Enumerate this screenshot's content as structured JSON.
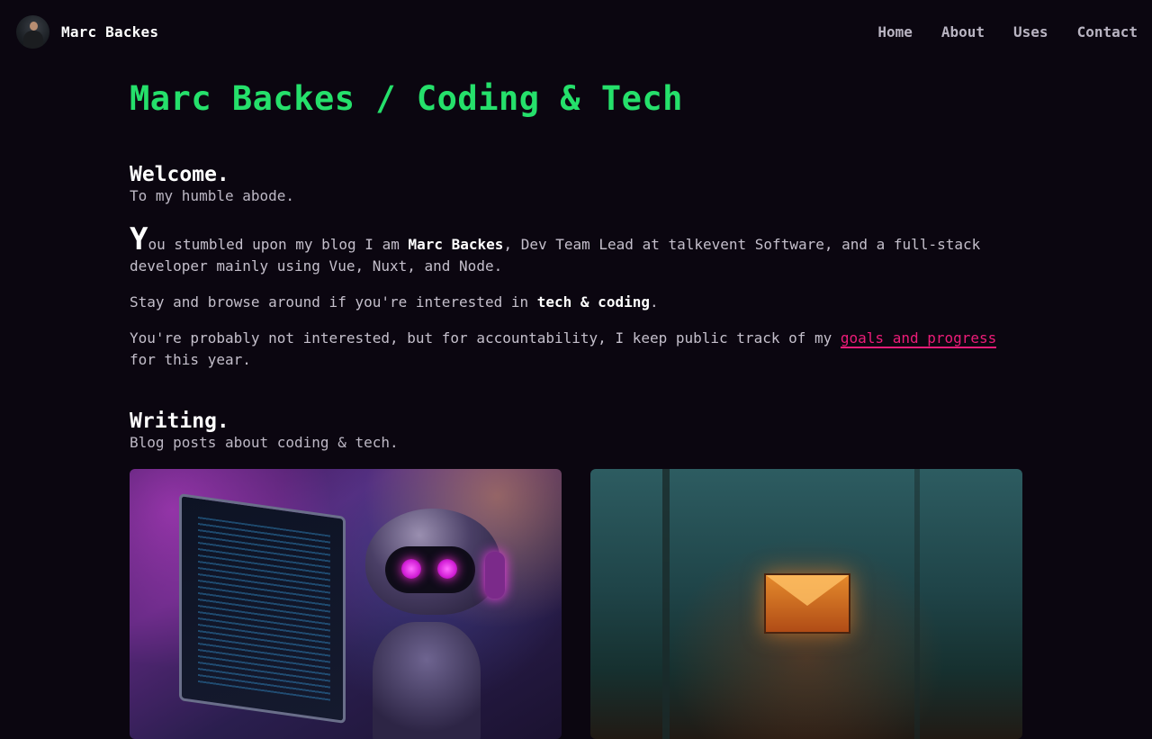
{
  "header": {
    "brand_name": "Marc Backes",
    "nav": [
      {
        "label": "Home"
      },
      {
        "label": "About"
      },
      {
        "label": "Uses"
      },
      {
        "label": "Contact"
      }
    ]
  },
  "page_title": "Marc Backes / Coding & Tech",
  "welcome": {
    "title": "Welcome.",
    "subtitle": "To my humble abode.",
    "p1": {
      "dropcap": "Y",
      "before": "ou stumbled upon my blog I am ",
      "name": "Marc Backes",
      "after": ", Dev Team Lead at talkevent Software, and a full-stack developer mainly using Vue, Nuxt, and Node."
    },
    "p2": {
      "before": "Stay and browse around if you're interested in ",
      "strong": "tech & coding",
      "after": "."
    },
    "p3": {
      "before": "You're probably not interested, but for accountability, I keep public track of my ",
      "link": "goals and progress",
      "after": " for this year."
    }
  },
  "writing": {
    "title": "Writing.",
    "subtitle": "Blog posts about coding & tech."
  },
  "colors": {
    "background": "#0b0610",
    "accent_green": "#25e06b",
    "accent_pink": "#ec1c78"
  }
}
